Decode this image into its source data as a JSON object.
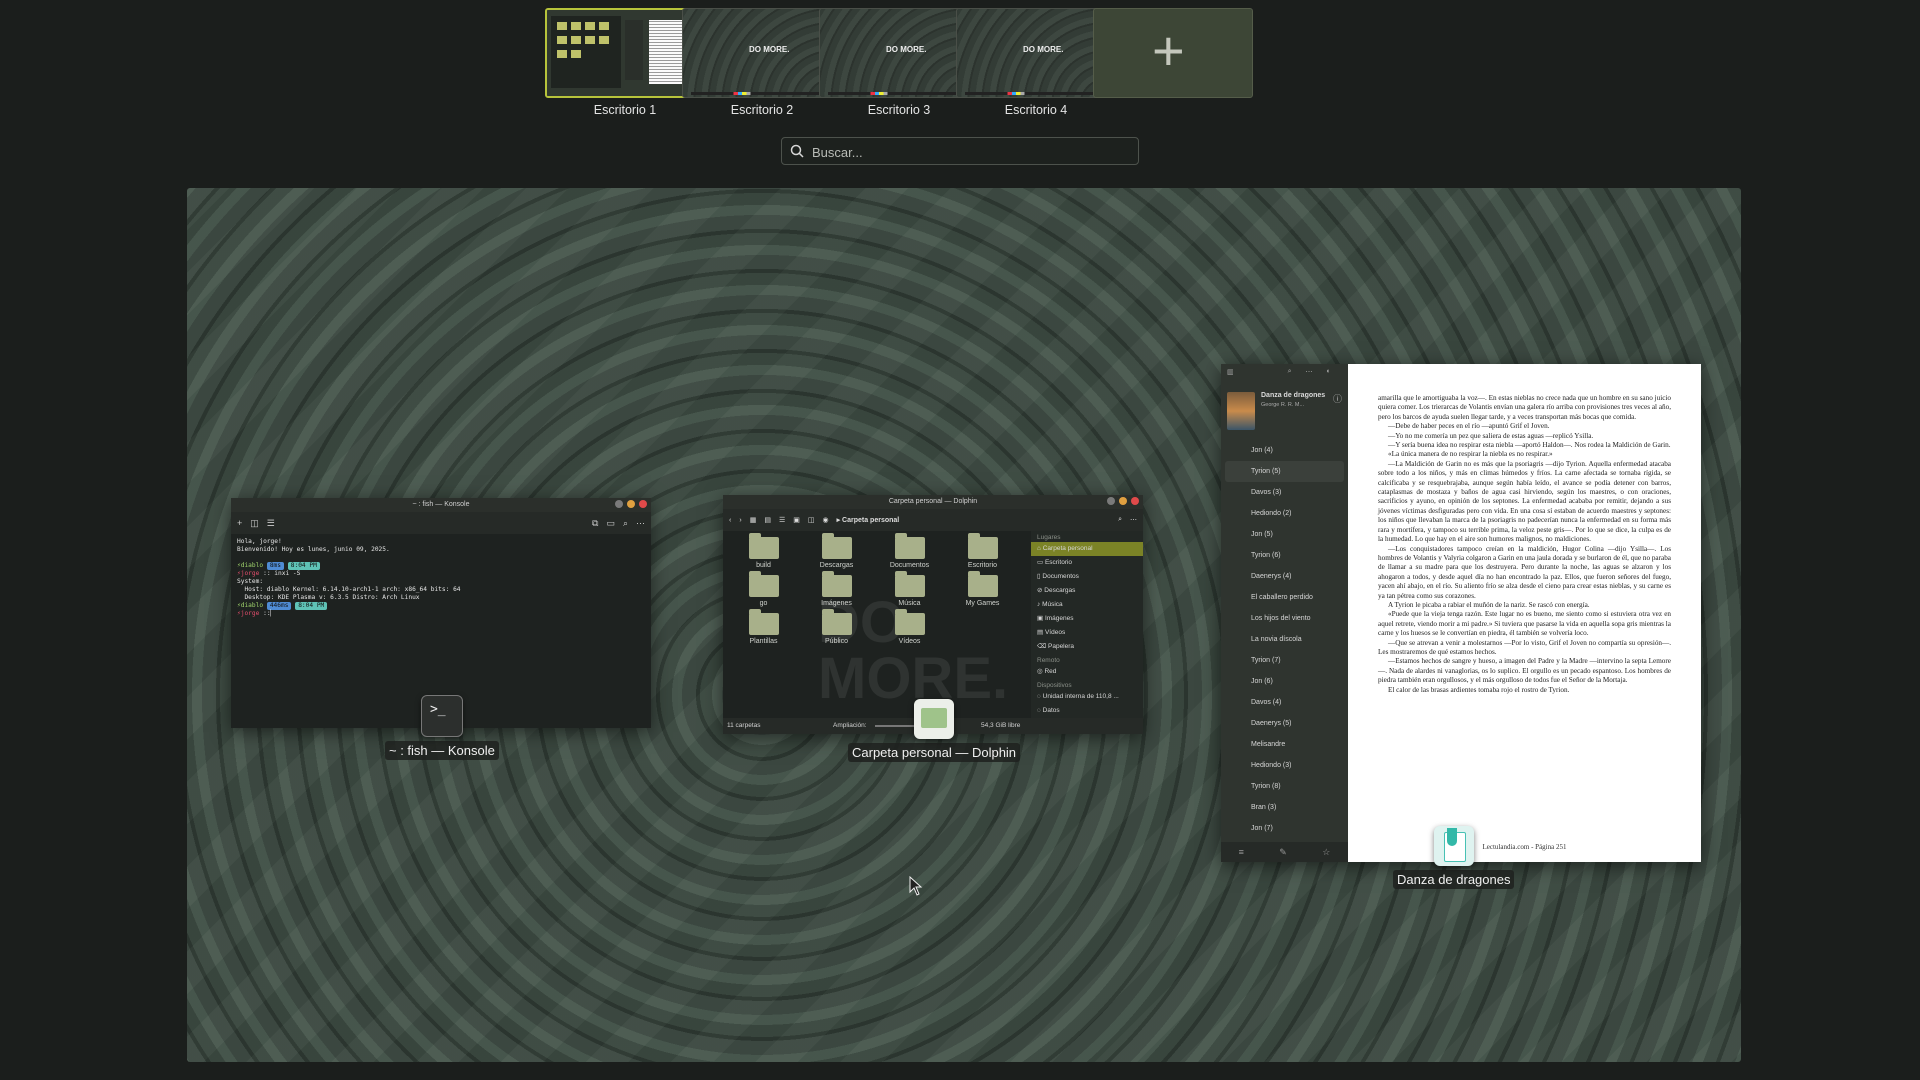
{
  "desktops": [
    {
      "label": "Escritorio 1",
      "active": true
    },
    {
      "label": "Escritorio 2",
      "active": false,
      "wallpaper_text": "DO MORE."
    },
    {
      "label": "Escritorio 3",
      "active": false,
      "wallpaper_text": "DO MORE."
    },
    {
      "label": "Escritorio 4",
      "active": false,
      "wallpaper_text": "DO MORE."
    }
  ],
  "search": {
    "placeholder": "Buscar..."
  },
  "colors": {
    "accent": "#b7c43b",
    "desktop_bg": "#3b4940",
    "panel_bg": "#1b1e1c"
  },
  "konsole": {
    "title": "~ : fish — Konsole",
    "label": "~ : fish — Konsole",
    "lines": [
      "Hola, jorge!",
      "Bienvenido! Hoy es lunes, junio 09, 2025.",
      "",
      "Host: diablo Kernel: 6.14.10-arch1-1 arch: x86_64 bits: 64",
      "Desktop: KDE Plasma v: 6.3.5 Distro: Arch Linux"
    ],
    "prompt_user": "diablo",
    "prompt_name": "jorge",
    "cmd": "inxi -S",
    "time1": "8:04 PM",
    "time2": "8:04 PM",
    "mem1": "8ms",
    "mem2": "446ms",
    "section": "System:"
  },
  "dolphin": {
    "title": "Carpeta personal — Dolphin",
    "label": "Carpeta personal — Dolphin",
    "crumb": "Carpeta personal",
    "folders": [
      "build",
      "Descargas",
      "Documentos",
      "Escritorio",
      "go",
      "Imágenes",
      "Música",
      "My Games",
      "Plantillas",
      "Público",
      "Vídeos"
    ],
    "sidebar_header": "Lugares",
    "sidebar": [
      "Carpeta personal",
      "Escritorio",
      "Documentos",
      "Descargas",
      "Música",
      "Imágenes",
      "Vídeos",
      "Papelera"
    ],
    "remote_header": "Remoto",
    "remote": [
      "Red"
    ],
    "devices_header": "Dispositivos",
    "devices": [
      "Unidad interna de 110,8 ...",
      "Datos"
    ],
    "status_count": "11 carpetas",
    "zoom_label": "Ampliación:",
    "free_space": "54,3 GiB libre",
    "watermark": "DO MORE."
  },
  "reader": {
    "label": "Danza de dragones",
    "book_title": "Danza de dragones",
    "author": "George R. R. M...",
    "toc": [
      "Jon (4)",
      "Tyrion (5)",
      "Davos (3)",
      "Hediondo (2)",
      "Jon (5)",
      "Tyrion (6)",
      "Daenerys (4)",
      "El caballero perdido",
      "Los hijos del viento",
      "La novia díscola",
      "Tyrion (7)",
      "Jon (6)",
      "Davos (4)",
      "Daenerys (5)",
      "Melisandre",
      "Hediondo (3)",
      "Tyrion (8)",
      "Bran (3)",
      "Jon (7)"
    ],
    "current_index": 1,
    "paragraphs": [
      "amarilla que le amortiguaba la voz—. En estas nieblas no crece nada que un hombre en su sano juicio quiera comer. Los trierarcas de Volantis envían una galera río arriba con provisiones tres veces al año, pero los barcos de ayuda suelen llegar tarde, y a veces transportan más bocas que comida.",
      "—Debe de haber peces en el río —apuntó Grif el Joven.",
      "—Yo no me comería un pez que saliera de estas aguas —replicó Ysilla.",
      "—Y sería buena idea no respirar esta niebla —aportó Haldon—. Nos rodea la Maldición de Garin.",
      "«La única manera de no respirar la niebla es no respirar.»",
      "—La Maldición de Garin no es más que la psoriagris —dijo Tyrion. Aquella enfermedad atacaba sobre todo a los niños, y más en climas húmedos y fríos. La carne afectada se tornaba rígida, se calcificaba y se resquebrajaba, aunque según había leído, el avance se podía detener con barros, cataplasmas de mostaza y baños de agua casi hirviendo, según los maestres, o con oraciones, sacrificios y ayuno, en opinión de los septones. La enfermedad acababa por remitir, dejando a sus jóvenes víctimas desfiguradas pero con vida. En una cosa sí estaban de acuerdo maestres y septones: los niños que llevaban la marca de la psoriagris no padecerían nunca la enfermedad en su forma más rara y mortífera, y tampoco su terrible prima, la veloz peste gris—. Por lo que se dice, la culpa es de la humedad. Lo que hay en el aire son humores malignos, no maldiciones.",
      "—Los conquistadores tampoco creían en la maldición, Hugor Colina —dijo Ysilla—. Los hombres de Volantis y Valyria colgaron a Garin en una jaula dorada y se burlaron de él, que no paraba de llamar a su madre para que los destruyera. Pero durante la noche, las aguas se alzaron y los ahogaron a todos, y desde aquel día no han encontrado la paz. Ellos, que fueron señores del fuego, yacen ahí abajo, en el río. Su aliento frío se alza desde el cieno para crear estas nieblas, y su carne es ya tan pétrea como sus corazones.",
      "A Tyrion le picaba a rabiar el muñón de la nariz. Se rascó con energía.",
      "«Puede que la vieja tenga razón. Este lugar no es bueno, me siento como si estuviera otra vez en aquel retrete, viendo morir a mi padre.» Si tuviera que pasarse la vida en aquella sopa gris mientras la carne y los huesos se le convertían en piedra, él también se volvería loco.",
      "—Que se atrevan a venir a molestarnos —Por lo visto, Grif el Joven no compartía su opresión—. Les mostraremos de qué estamos hechos.",
      "—Estamos hechos de sangre y hueso, a imagen del Padre y la Madre —intervino la septa Lemore—. Nada de alardes ni vanaglorias, os lo suplico. El orgullo es un pecado espantoso. Los hombres de piedra también eran orgullosos, y el más orgulloso de todos fue el Señor de la Mortaja.",
      "El calor de las brasas ardientes tomaba rojo el rostro de Tyrion."
    ],
    "footer": "Lectulandia.com - Página 251"
  }
}
